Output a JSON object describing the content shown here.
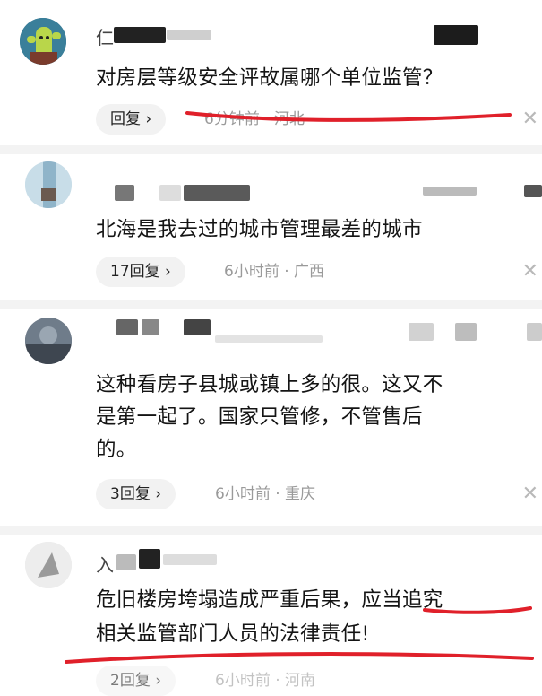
{
  "comments": [
    {
      "username_prefix": "仁",
      "text": "对房层等级安全评故属哪个单位监管？",
      "reply_label": "回复 ›",
      "meta": "6分钟前 · 河北",
      "close": "✕"
    },
    {
      "text": "北海是我去过的城市管理最差的城市",
      "reply_label": "17回复 ›",
      "meta": "6小时前 · 广西",
      "close": "✕"
    },
    {
      "text_line1": "这种看房子县城或镇上多的很。这又不",
      "text_line2": "是第一起了。国家只管修，不管售后",
      "text_line3": "的。",
      "reply_label": "3回复 ›",
      "meta": "6小时前 · 重庆",
      "close": "✕"
    },
    {
      "username_prefix": "入",
      "text_line1": "危旧楼房垮塌造成严重后果，应当追究",
      "text_line2": "相关监管部门人员的法律责任!",
      "reply_label": "2回复 ›",
      "meta": "6小时前 · 河南"
    }
  ],
  "annotation_color": "#e0202a"
}
